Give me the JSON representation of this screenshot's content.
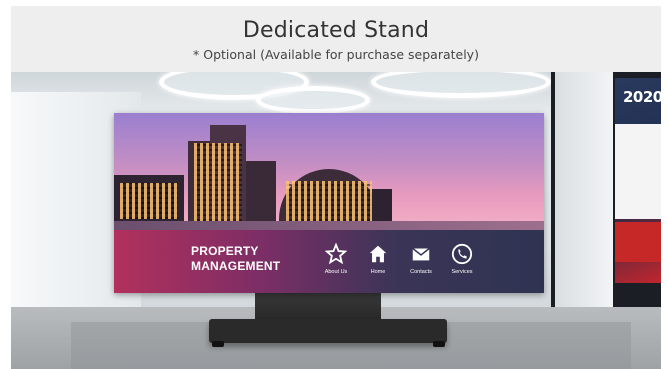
{
  "header": {
    "title": "Dedicated Stand",
    "subtitle": "* Optional (Available for purchase separately)"
  },
  "scene": {
    "banner_year": "2020"
  },
  "display": {
    "title_line1": "PROPERTY",
    "title_line2": "MANAGEMENT",
    "nav": [
      {
        "label": "About Us",
        "icon": "star-icon"
      },
      {
        "label": "Home",
        "icon": "home-icon"
      },
      {
        "label": "Contacts",
        "icon": "envelope-icon"
      },
      {
        "label": "Services",
        "icon": "phone-icon"
      }
    ]
  },
  "colors": {
    "header_bg": "#eeeeee",
    "panel_start": "#b2305c",
    "panel_end": "#2f3352"
  }
}
